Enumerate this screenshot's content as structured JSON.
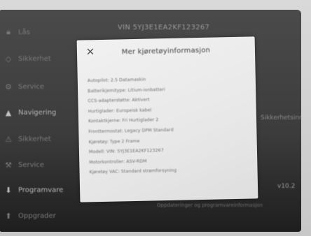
{
  "screen": {
    "vin_header": "VIN 5YJ3E1EA2KF123267",
    "sidebar": [
      {
        "label": "Lås",
        "icon": "lock-icon"
      },
      {
        "label": "Sikkerhet",
        "icon": "shield-icon"
      },
      {
        "label": "Service",
        "icon": "wrench-icon"
      },
      {
        "label": "Navigering",
        "icon": "navigation-arrow-icon"
      },
      {
        "label": "Sikkerhet",
        "icon": "warning-icon"
      },
      {
        "label": "Service",
        "icon": "service-icon"
      },
      {
        "label": "Programvare",
        "icon": "download-icon"
      },
      {
        "label": "Oppgrader",
        "icon": "upgrade-icon"
      }
    ],
    "right_label": "Sikkerhetsinnstillinger",
    "right_version": "v10.2",
    "below_text": "Oppdateringer og programvareinformasjon"
  },
  "modal": {
    "title": "Mer kjøretøyinformasjon",
    "close_symbol": "✕",
    "rows": [
      "Autopilot: 2.5 Datamaskin",
      "Batterikjemitype: Litium-ionbatteri",
      "CCS-adapterstøtte: Aktivert",
      "Hurtiglader: Europeisk kabel",
      "Kontaktkjerne: Fri Hurtiglader 2",
      "Fronttermostat: Legacy DPM Standard",
      "Kjøretøy: Type 2 Frame",
      "Modell: VIN: 5YJ3E1EA2KF123267",
      "Motorkontroller: ASV-RDM",
      "Kjøretøy VAC: Standard strømforsyning"
    ]
  },
  "colors": {
    "screen_bg": "#3c3c3c",
    "modal_bg": "#ececec",
    "bezel": "#cfcfcf"
  }
}
